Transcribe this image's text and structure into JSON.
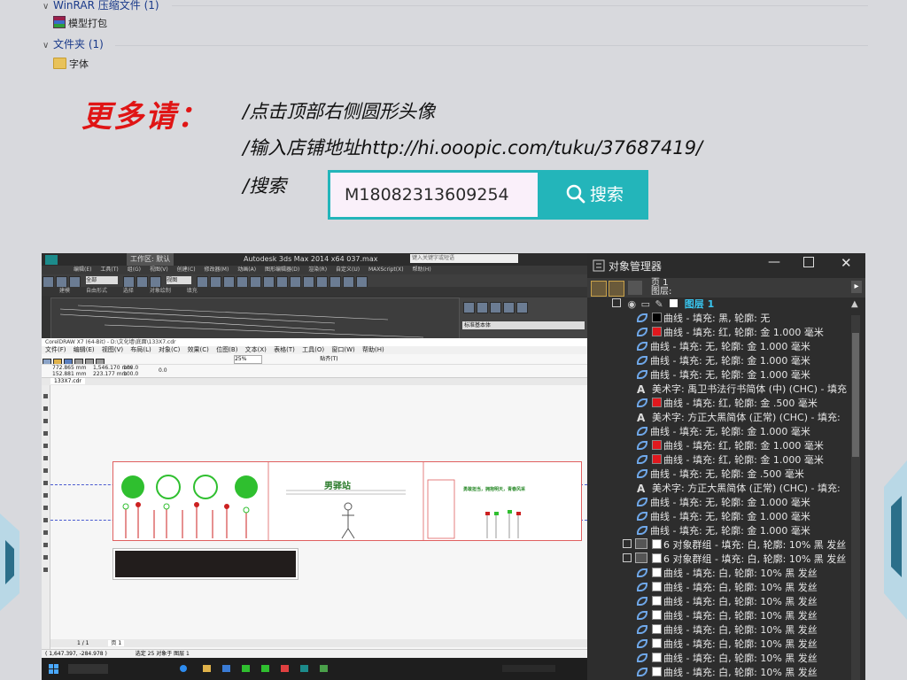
{
  "explorer": {
    "groups": [
      {
        "header": "WinRAR 压缩文件 (1)",
        "items": [
          "模型打包"
        ]
      },
      {
        "header": "文件夹 (1)",
        "items": [
          "字体"
        ]
      }
    ]
  },
  "promo": {
    "headline": "更多请：",
    "line1": "/点击顶部右侧圆形头像",
    "line2": "/输入店铺地址http://hi.ooopic.com/tuku/37687419/",
    "line3": "/搜索",
    "search_value": "M18082313609254",
    "search_button": "搜索"
  },
  "max": {
    "title": "Autodesk 3ds Max  2014 x64      037.max",
    "workspace": "工作区: 默认",
    "search_placeholder": "键入关键字或短语",
    "menus": [
      "编辑(E)",
      "工具(T)",
      "组(G)",
      "视图(V)",
      "创建(C)",
      "修改器(M)",
      "动画(A)",
      "图形编辑器(D)",
      "渲染(R)",
      "自定义(U)",
      "MAXScript(X)",
      "帮助(H)"
    ],
    "view_select": "全部",
    "view_label": "视图",
    "tabs": [
      "建模",
      "自由形式",
      "选择",
      "对象绘制",
      "填充"
    ],
    "side_label": "标准基本体"
  },
  "coreldraw": {
    "title": "CorelDRAW X7 (64-Bit) - D:\\文化墙\\底面\\133X7.cdr",
    "menus": [
      "文件(F)",
      "编辑(E)",
      "视图(V)",
      "布局(L)",
      "对象(C)",
      "效果(C)",
      "位图(B)",
      "文本(X)",
      "表格(T)",
      "工具(O)",
      "窗口(W)",
      "帮助(H)"
    ],
    "zoom": "25%",
    "snap": "贴齐(T)",
    "x": "772.865 mm",
    "y": "152.881 mm",
    "w": "1,546.170 mm",
    "h": "223.177 mm",
    "scale_w": "100.0",
    "scale_h": "100.0",
    "angle": "0.0",
    "doc_tab": "133X7.cdr",
    "page_nav": "1 / 1",
    "page_tab": "页 1",
    "status_coords": "( 1,647.397, -284.978 )",
    "status_sel": "选定 25 对象于 图层 1",
    "panel_title": "男驿站",
    "banner_text": "勇敢担当，拥抱明天，青春风采"
  },
  "object_manager": {
    "title": "对象管理器",
    "page_label": "页 1",
    "layer_label": "图层:",
    "layer_name": "图层 1",
    "rows": [
      {
        "type": "curve",
        "text": "曲线 - 填充: 黑, 轮廓: 无",
        "fill": "#000000"
      },
      {
        "type": "curve",
        "text": "曲线 - 填充: 红, 轮廓: 金 1.000 毫米",
        "fill": "#e0181e"
      },
      {
        "type": "curve",
        "text": "曲线 - 填充: 无, 轮廓: 金 1.000 毫米",
        "fill": ""
      },
      {
        "type": "curve",
        "text": "曲线 - 填充: 无, 轮廓: 金 1.000 毫米",
        "fill": ""
      },
      {
        "type": "curve",
        "text": "曲线 - 填充: 无, 轮廓: 金 1.000 毫米",
        "fill": ""
      },
      {
        "type": "text",
        "text": "美术字: 禹卫书法行书简体 (中) (CHC) - 填充",
        "fill": ""
      },
      {
        "type": "curve",
        "text": "曲线 - 填充: 红, 轮廓: 金 .500 毫米",
        "fill": "#e0181e"
      },
      {
        "type": "text",
        "text": "美术字: 方正大黑简体 (正常) (CHC) - 填充:",
        "fill": ""
      },
      {
        "type": "curve",
        "text": "曲线 - 填充: 无, 轮廓: 金 1.000 毫米",
        "fill": ""
      },
      {
        "type": "curve",
        "text": "曲线 - 填充: 红, 轮廓: 金 1.000 毫米",
        "fill": "#e0181e"
      },
      {
        "type": "curve",
        "text": "曲线 - 填充: 红, 轮廓: 金 1.000 毫米",
        "fill": "#e0181e"
      },
      {
        "type": "curve",
        "text": "曲线 - 填充: 无, 轮廓: 金 .500 毫米",
        "fill": ""
      },
      {
        "type": "text",
        "text": "美术字: 方正大黑简体 (正常) (CHC) - 填充:",
        "fill": ""
      },
      {
        "type": "curve",
        "text": "曲线 - 填充: 无, 轮廓: 金 1.000 毫米",
        "fill": ""
      },
      {
        "type": "curve",
        "text": "曲线 - 填充: 无, 轮廓: 金 1.000 毫米",
        "fill": ""
      },
      {
        "type": "curve",
        "text": "曲线 - 填充: 无, 轮廓: 金 1.000 毫米",
        "fill": ""
      },
      {
        "type": "group",
        "text": "6 对象群组 - 填充: 白, 轮廓: 10% 黑 发丝",
        "fill": "#ffffff"
      },
      {
        "type": "group",
        "text": "6 对象群组 - 填充: 白, 轮廓: 10% 黑 发丝",
        "fill": "#ffffff"
      },
      {
        "type": "curve",
        "text": "曲线 - 填充: 白, 轮廓: 10% 黑 发丝",
        "fill": "#ffffff"
      },
      {
        "type": "curve",
        "text": "曲线 - 填充: 白, 轮廓: 10% 黑 发丝",
        "fill": "#ffffff"
      },
      {
        "type": "curve",
        "text": "曲线 - 填充: 白, 轮廓: 10% 黑 发丝",
        "fill": "#ffffff"
      },
      {
        "type": "curve",
        "text": "曲线 - 填充: 白, 轮廓: 10% 黑 发丝",
        "fill": "#ffffff"
      },
      {
        "type": "curve",
        "text": "曲线 - 填充: 白, 轮廓: 10% 黑 发丝",
        "fill": "#ffffff"
      },
      {
        "type": "curve",
        "text": "曲线 - 填充: 白, 轮廓: 10% 黑 发丝",
        "fill": "#ffffff"
      },
      {
        "type": "curve",
        "text": "曲线 - 填充: 白, 轮廓: 10% 黑 发丝",
        "fill": "#ffffff"
      },
      {
        "type": "curve",
        "text": "曲线 - 填充: 白, 轮廓: 10% 黑 发丝",
        "fill": "#ffffff"
      },
      {
        "type": "curve",
        "text": "曲线 - 填充: 白, 轮廓: 10% 黑 发丝",
        "fill": "#ffffff"
      },
      {
        "type": "curve",
        "text": "曲线 - 填充: 白, 轮廓: 10% 黑 发丝",
        "fill": "#ffffff"
      }
    ]
  },
  "colors": {
    "accent": "#23b5ba",
    "promo_red": "#e01515",
    "layer_blue": "#39c6f0"
  }
}
